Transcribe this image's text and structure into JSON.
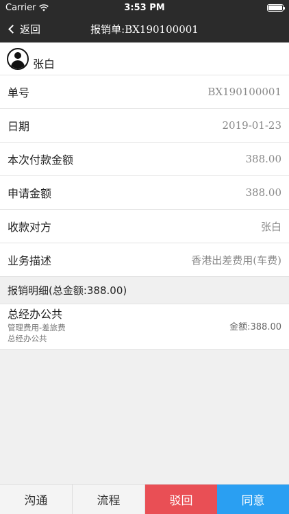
{
  "status_bar": {
    "carrier": "Carrier",
    "time": "3:53 PM"
  },
  "nav": {
    "back_label": "返回",
    "title": "报销单:BX190100001"
  },
  "user": {
    "name": "张白"
  },
  "fields": [
    {
      "label": "单号",
      "value": "BX190100001"
    },
    {
      "label": "日期",
      "value": "2019-01-23"
    },
    {
      "label": "本次付款金额",
      "value": "388.00"
    },
    {
      "label": "申请金额",
      "value": "388.00"
    },
    {
      "label": "收款对方",
      "value": "张白"
    },
    {
      "label": "业务描述",
      "value": "香港出差费用(车费)"
    }
  ],
  "details_section": {
    "header": "报销明细(总金额:388.00)",
    "items": [
      {
        "title": "总经办公共",
        "category": "管理费用-差旅费",
        "department": "总经办公共",
        "amount": "金额:388.00"
      }
    ]
  },
  "actions": {
    "communicate": "沟通",
    "process": "流程",
    "reject": "驳回",
    "approve": "同意"
  },
  "colors": {
    "nav_bg": "#2b2b2b",
    "reject": "#e94f55",
    "approve": "#2a9ff2"
  }
}
